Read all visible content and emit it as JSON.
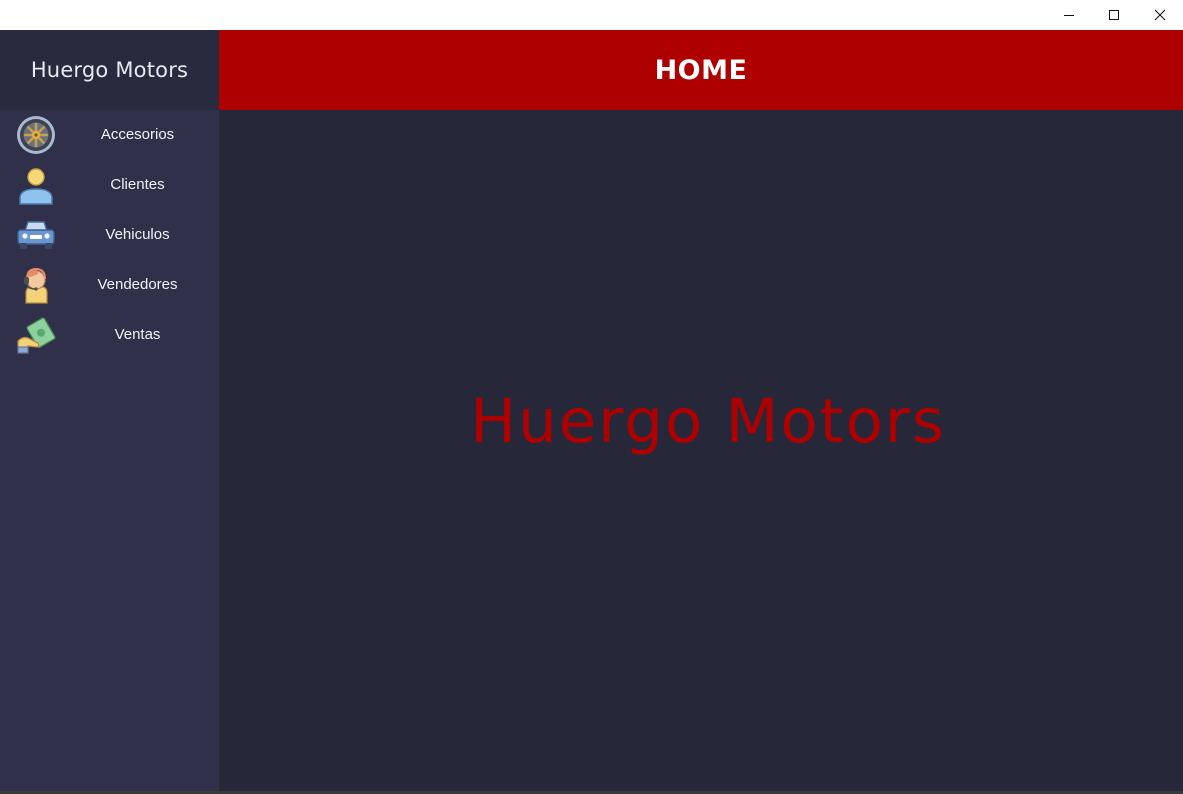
{
  "window": {
    "controls": [
      "minimize-icon",
      "maximize-icon",
      "close-icon"
    ]
  },
  "sidebar": {
    "brand": "Huergo Motors",
    "items": [
      {
        "label": "Accesorios",
        "icon": "wheel-icon"
      },
      {
        "label": "Clientes",
        "icon": "person-icon"
      },
      {
        "label": "Vehiculos",
        "icon": "car-icon"
      },
      {
        "label": "Vendedores",
        "icon": "salesperson-headset-icon"
      },
      {
        "label": "Ventas",
        "icon": "money-hand-icon"
      }
    ]
  },
  "header": {
    "title": "HOME"
  },
  "main": {
    "hero_text": "Huergo Motors"
  },
  "colors": {
    "accent_red": "#ae0000",
    "sidebar_bg": "#30304a",
    "brand_bg": "#282a3e",
    "main_bg": "#262839"
  }
}
